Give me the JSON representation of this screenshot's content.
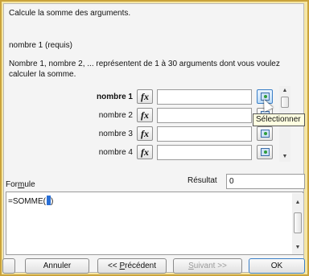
{
  "description": "Calcule la somme des arguments.",
  "param_title": "nombre 1 (requis)",
  "param_desc": "Nombre 1, nombre 2, ... représentent de 1 à 30 arguments dont vous voulez calculer la somme.",
  "args": [
    {
      "label": "nombre 1"
    },
    {
      "label": "nombre 2"
    },
    {
      "label": "nombre 3"
    },
    {
      "label": "nombre 4"
    }
  ],
  "fx_label": "fx",
  "tooltip": "Sélectionner",
  "result_label": "Résultat",
  "result_value": "0",
  "formula_label_prefix": "For",
  "formula_label_underlined": "m",
  "formula_label_suffix": "ule",
  "formula_text": "=SOMME(",
  "formula_text_end": ")",
  "buttons": {
    "cancel": "Annuler",
    "previous_prefix": "<< ",
    "previous_underlined": "P",
    "previous_suffix": "récédent",
    "next_underlined": "S",
    "next_suffix": "uivant >>",
    "ok": "OK"
  }
}
